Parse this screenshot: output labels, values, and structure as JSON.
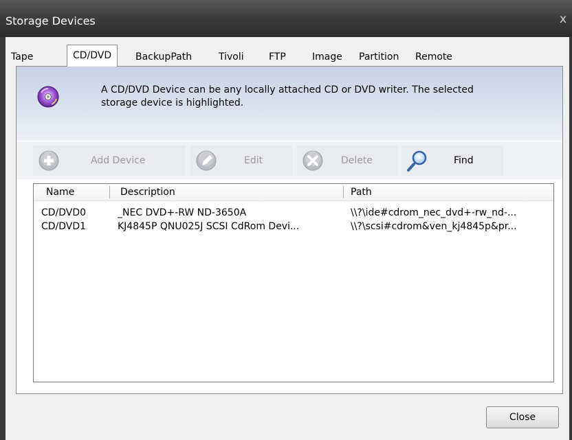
{
  "window": {
    "title": "Storage Devices",
    "close_glyph": "x"
  },
  "tabs": [
    {
      "label": "Tape"
    },
    {
      "label": "CD/DVD",
      "active": true
    },
    {
      "label": "BackupPath"
    },
    {
      "label": "Tivoli"
    },
    {
      "label": "FTP"
    },
    {
      "label": "Image"
    },
    {
      "label": "Partition"
    },
    {
      "label": "Remote"
    }
  ],
  "banner": {
    "icon": "cd-disc-icon",
    "line1": "A CD/DVD Device can be any locally attached CD or DVD writer.  The selected",
    "line2": "storage device is highlighted."
  },
  "toolbar": {
    "add_label": "Add Device",
    "edit_label": "Edit",
    "delete_label": "Delete",
    "find_label": "Find"
  },
  "list": {
    "columns": [
      "Name",
      "Description",
      "Path"
    ],
    "rows": [
      {
        "name": "CD/DVD0",
        "description": "_NEC DVD+-RW ND-3650A",
        "path": "\\\\?\\ide#cdrom_nec_dvd+-rw_nd-..."
      },
      {
        "name": "CD/DVD1",
        "description": "KJ4845P QNU025J SCSI CdRom Devi...",
        "path": "\\\\?\\scsi#cdrom&ven_kj4845p&pr..."
      }
    ]
  },
  "footer": {
    "close_label": "Close"
  }
}
